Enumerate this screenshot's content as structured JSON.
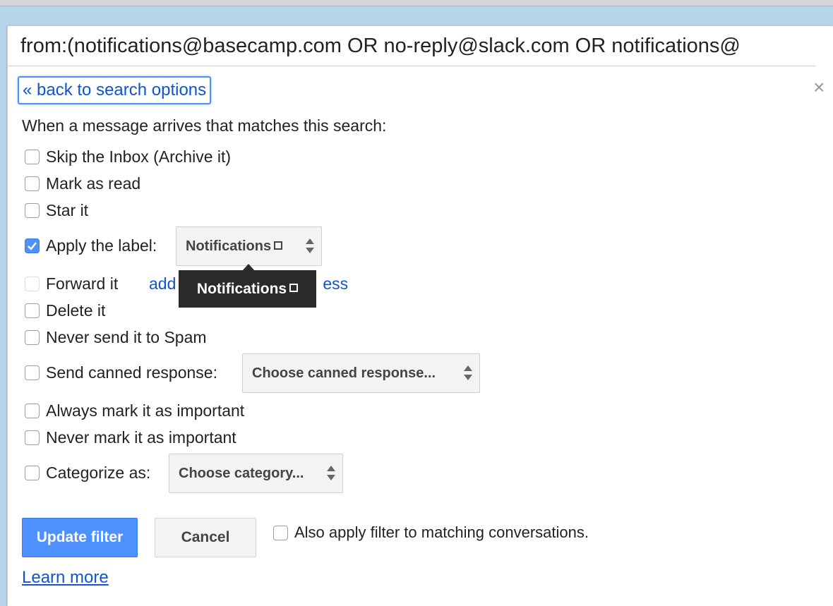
{
  "search": {
    "query": "from:(notifications@basecamp.com OR no-reply@slack.com OR notifications@"
  },
  "dialog": {
    "back_link": "« back to search options",
    "close_glyph": "×",
    "intro": "When a message arrives that matches this search:"
  },
  "actions": [
    {
      "label": "Skip the Inbox (Archive it)",
      "checked": false
    },
    {
      "label": "Mark as read",
      "checked": false
    },
    {
      "label": "Star it",
      "checked": false
    },
    {
      "label": "Apply the label:",
      "checked": true
    },
    {
      "label": "Forward it",
      "checked": false
    },
    {
      "label": "Delete it",
      "checked": false
    },
    {
      "label": "Never send it to Spam",
      "checked": false
    },
    {
      "label": "Send canned response:",
      "checked": false
    },
    {
      "label": "Always mark it as important",
      "checked": false
    },
    {
      "label": "Never mark it as important",
      "checked": false
    },
    {
      "label": "Categorize as:",
      "checked": false
    }
  ],
  "label_select": {
    "value": "Notifications"
  },
  "forward_link": "add forwarding address",
  "forward_link_visible": "add",
  "forward_link_tail": "ess",
  "tooltip": {
    "text": "Notifications"
  },
  "canned_select": {
    "value": "Choose canned response..."
  },
  "category_select": {
    "value": "Choose category..."
  },
  "buttons": {
    "update": "Update filter",
    "cancel": "Cancel"
  },
  "also_apply": {
    "label": "Also apply filter to matching conversations.",
    "checked": false
  },
  "learn_more": "Learn more",
  "icons": {
    "checkmark": "check-icon",
    "close": "close-icon",
    "select_arrows": "updown-arrows-icon",
    "label_square": "square-icon"
  },
  "colors": {
    "primary": "#4d90fe",
    "link": "#1155cc",
    "backdrop": "#b6d4ea",
    "tooltip": "#2a2a2a"
  }
}
